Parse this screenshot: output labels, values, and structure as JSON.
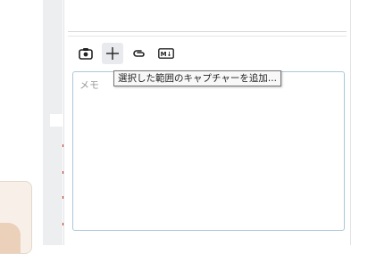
{
  "toolbar": {
    "items": [
      {
        "name": "camera-icon"
      },
      {
        "name": "crosshair-icon"
      },
      {
        "name": "paperclip-icon"
      },
      {
        "name": "markdown-icon",
        "glyph": "M↓"
      }
    ],
    "tooltip": "選択した範囲のキャプチャーを追加..."
  },
  "memo": {
    "placeholder": "メモ",
    "value": ""
  },
  "colors": {
    "accent_border": "#a9c9d9",
    "active_tool_bg": "#e8eaed"
  }
}
